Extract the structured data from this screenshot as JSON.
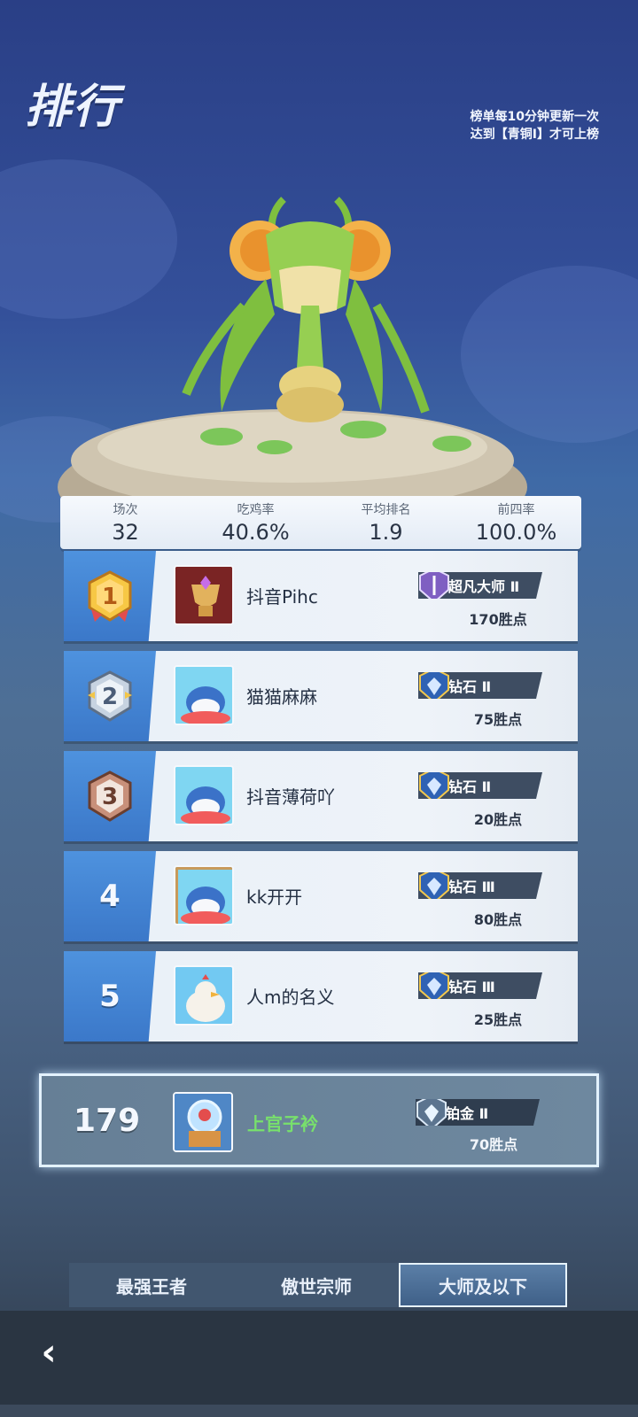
{
  "header": {
    "title": "排行",
    "notes": [
      "榜单每10分钟更新一次",
      "达到【青铜Ⅰ】才可上榜"
    ]
  },
  "stats": [
    {
      "label": "场次",
      "value": "32"
    },
    {
      "label": "吃鸡率",
      "value": "40.6%"
    },
    {
      "label": "平均排名",
      "value": "1.9"
    },
    {
      "label": "前四率",
      "value": "100.0%"
    }
  ],
  "leaderboard": [
    {
      "rank": "1",
      "name": "抖音Pihc",
      "tier": "超凡大师 Ⅱ",
      "points": "170胜点",
      "tier_icon": "purple-crest-icon"
    },
    {
      "rank": "2",
      "name": "猫猫麻麻",
      "tier": "钻石 Ⅱ",
      "points": "75胜点",
      "tier_icon": "diamond-shield-icon"
    },
    {
      "rank": "3",
      "name": "抖音薄荷吖",
      "tier": "钻石 Ⅱ",
      "points": "20胜点",
      "tier_icon": "diamond-shield-icon"
    },
    {
      "rank": "4",
      "name": "kk开开",
      "tier": "钻石 Ⅲ",
      "points": "80胜点",
      "tier_icon": "diamond-shield-icon"
    },
    {
      "rank": "5",
      "name": "人m的名义",
      "tier": "钻石 Ⅲ",
      "points": "25胜点",
      "tier_icon": "diamond-shield-icon"
    }
  ],
  "self": {
    "rank": "179",
    "name": "上官子衿",
    "tier": "铂金 Ⅱ",
    "points": "70胜点",
    "tier_icon": "platinum-shield-icon"
  },
  "tabs": [
    {
      "label": "最强王者",
      "active": false
    },
    {
      "label": "傲世宗师",
      "active": false
    },
    {
      "label": "大师及以下",
      "active": true
    }
  ],
  "colors": {
    "accent": "#4e92de",
    "self_name": "#78e06c"
  }
}
